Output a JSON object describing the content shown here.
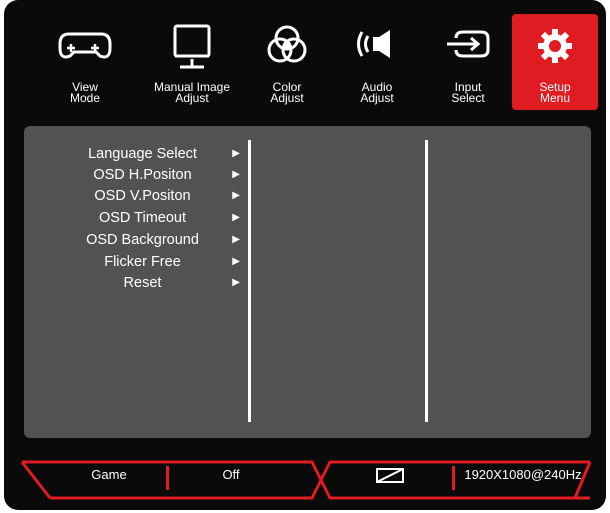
{
  "tabs": [
    {
      "label_line1": "View",
      "label_line2": "Mode",
      "icon": "gamepad-icon"
    },
    {
      "label_line1": "Manual Image",
      "label_line2": "Adjust",
      "icon": "monitor-icon"
    },
    {
      "label_line1": "Color",
      "label_line2": "Adjust",
      "icon": "color-circles-icon"
    },
    {
      "label_line1": "Audio",
      "label_line2": "Adjust",
      "icon": "speaker-icon"
    },
    {
      "label_line1": "Input",
      "label_line2": "Select",
      "icon": "input-arrow-icon"
    },
    {
      "label_line1": "Setup",
      "label_line2": "Menu",
      "icon": "gear-icon"
    }
  ],
  "active_tab": "Setup Menu",
  "menu_items": [
    {
      "label": "Language Select",
      "arrow": "▶"
    },
    {
      "label": "OSD H.Positon",
      "arrow": "▶"
    },
    {
      "label": "OSD V.Positon",
      "arrow": "▶"
    },
    {
      "label": "OSD Timeout",
      "arrow": "▶"
    },
    {
      "label": "OSD Background",
      "arrow": "▶"
    },
    {
      "label": "Flicker Free",
      "arrow": "▶"
    },
    {
      "label": "Reset",
      "arrow": "▶"
    }
  ],
  "status_bar": {
    "mode": "Game",
    "setting": "Off",
    "aspect_icon": "aspect-ratio-icon",
    "resolution": "1920X1080@240Hz"
  },
  "colors": {
    "accent": "#e01b22",
    "background": "#0a0a0a",
    "panel": "#525252",
    "text": "#ffffff"
  }
}
